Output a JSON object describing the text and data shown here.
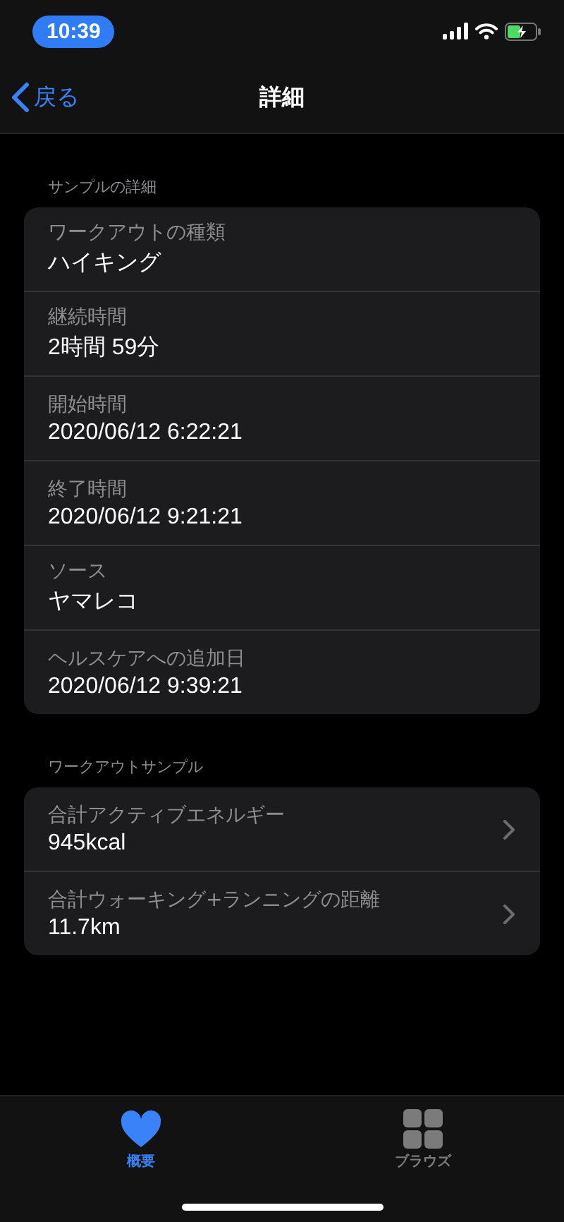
{
  "status_bar": {
    "time": "10:39"
  },
  "nav": {
    "back": "戻る",
    "title": "詳細"
  },
  "sections": [
    {
      "header": "サンプルの詳細",
      "rows": [
        {
          "kind": "plain",
          "label": "ワークアウトの種類",
          "value": "ハイキング"
        },
        {
          "kind": "plain",
          "label": "継続時間",
          "value": "2時間 59分"
        },
        {
          "kind": "plain",
          "label": "開始時間",
          "value": "2020/06/12 6:22:21"
        },
        {
          "kind": "plain",
          "label": "終了時間",
          "value": "2020/06/12 9:21:21"
        },
        {
          "kind": "plain",
          "label": "ソース",
          "value": "ヤマレコ"
        },
        {
          "kind": "plain",
          "label": "ヘルスケアへの追加日",
          "value": "2020/06/12 9:39:21"
        }
      ]
    },
    {
      "header": "ワークアウトサンプル",
      "rows": [
        {
          "kind": "link",
          "label": "合計アクティブエネルギー",
          "value": "945kcal"
        },
        {
          "kind": "link",
          "label": "合計ウォーキング+ランニングの距離",
          "value": "11.7km"
        }
      ]
    }
  ],
  "tab_bar": [
    {
      "kind": "heart",
      "label": "概要",
      "selected": true
    },
    {
      "kind": "grid",
      "label": "ブラウズ",
      "selected": false
    }
  ]
}
